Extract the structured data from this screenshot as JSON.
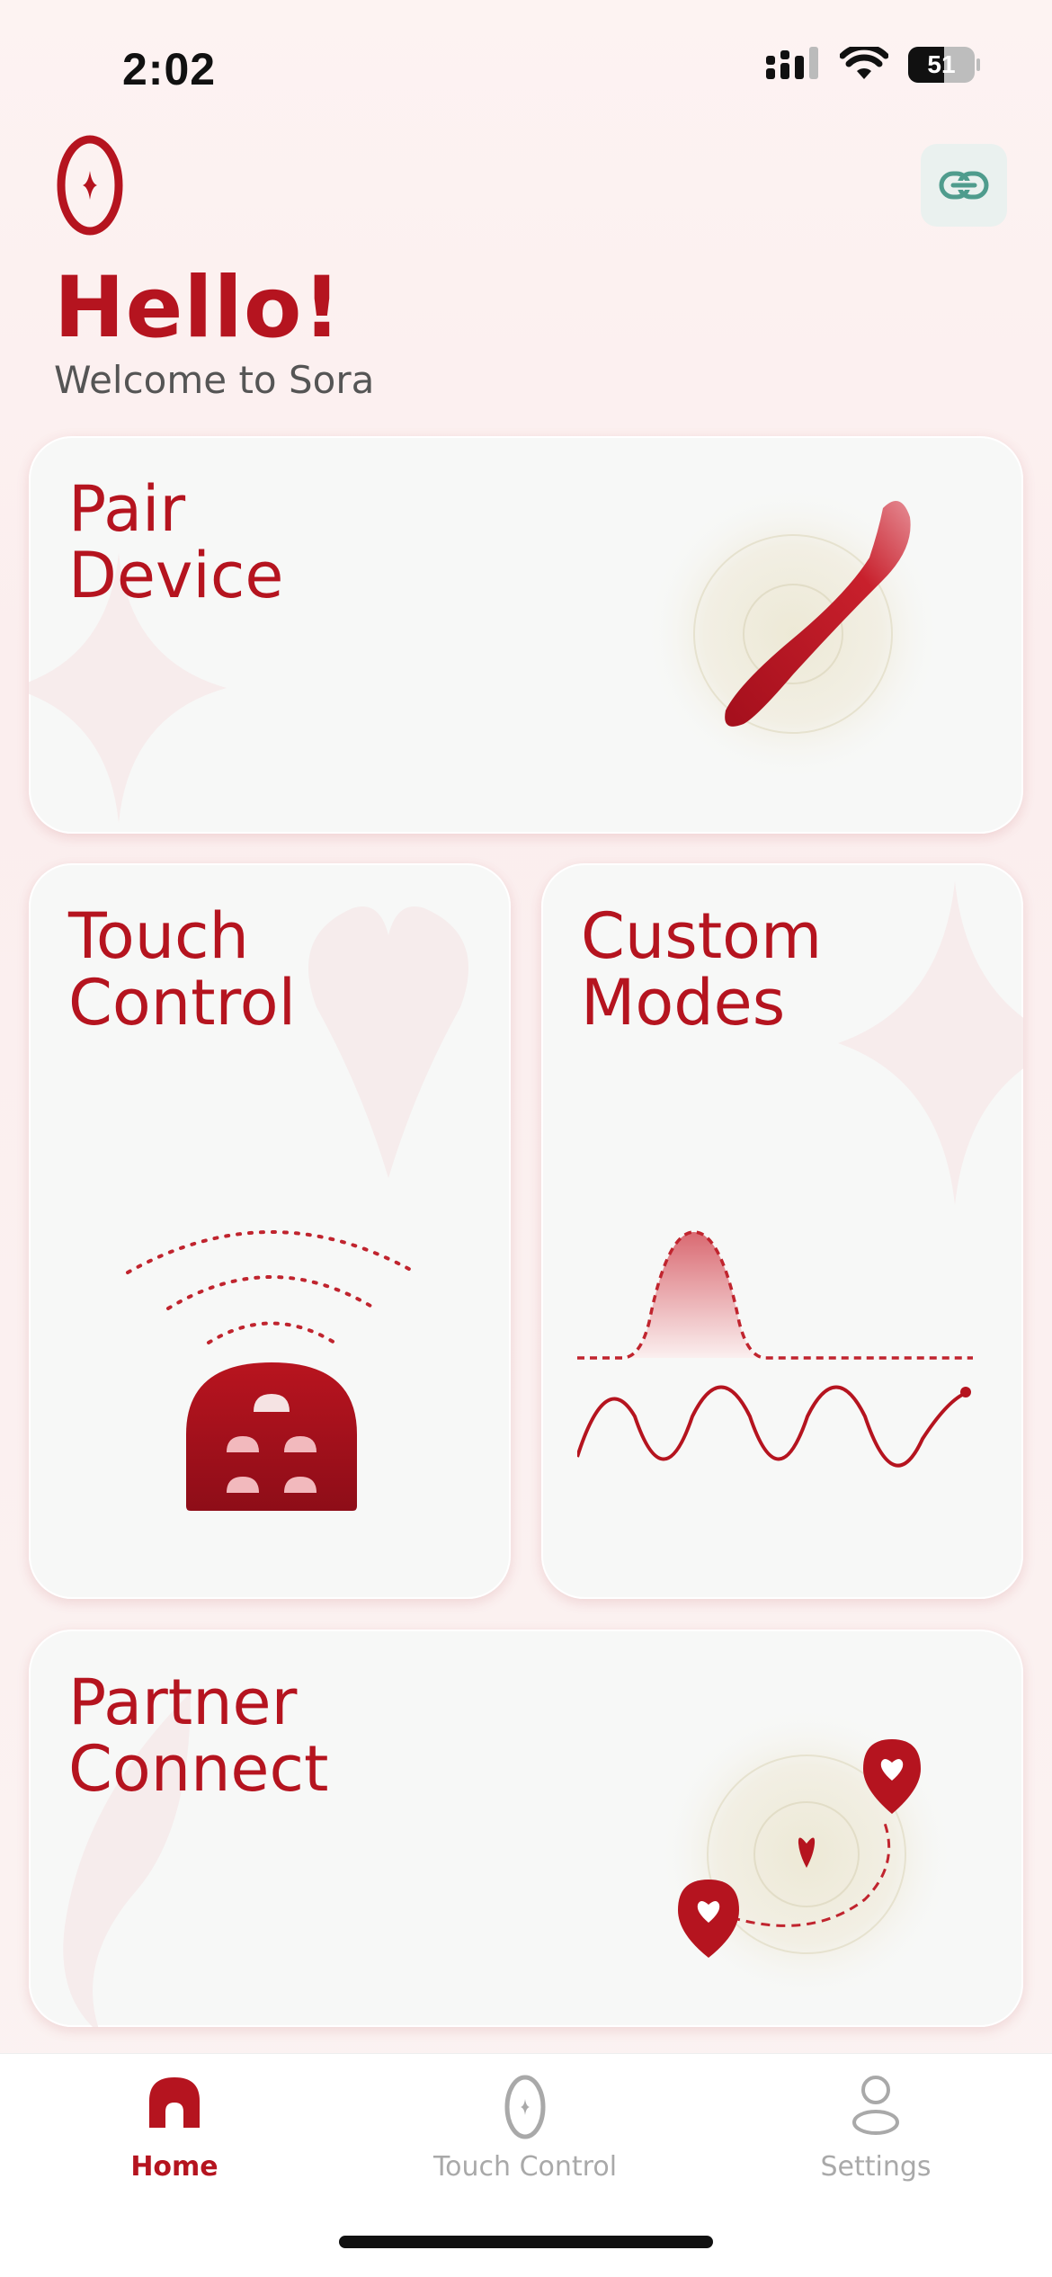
{
  "status_bar": {
    "time": "2:02",
    "battery": "51"
  },
  "header": {
    "greeting": "Hello!",
    "subtitle": "Welcome to Sora"
  },
  "cards": {
    "pair_device": "Pair\nDevice",
    "touch_control": "Touch\nControl",
    "custom_modes": "Custom\nModes",
    "partner_connect": "Partner\nConnect"
  },
  "tabbar": {
    "home": "Home",
    "touch_control": "Touch Control",
    "settings": "Settings",
    "active": "Home"
  },
  "colors": {
    "accent": "#b5141f",
    "inactive": "#a9a9a9",
    "card_bg": "#f7f8f7",
    "background": "#fbf1f0"
  },
  "icons": [
    "signal-icon",
    "wifi-icon",
    "battery-icon",
    "sora-logo-icon",
    "link-icon",
    "home-icon",
    "touch-control-icon",
    "settings-person-icon"
  ]
}
